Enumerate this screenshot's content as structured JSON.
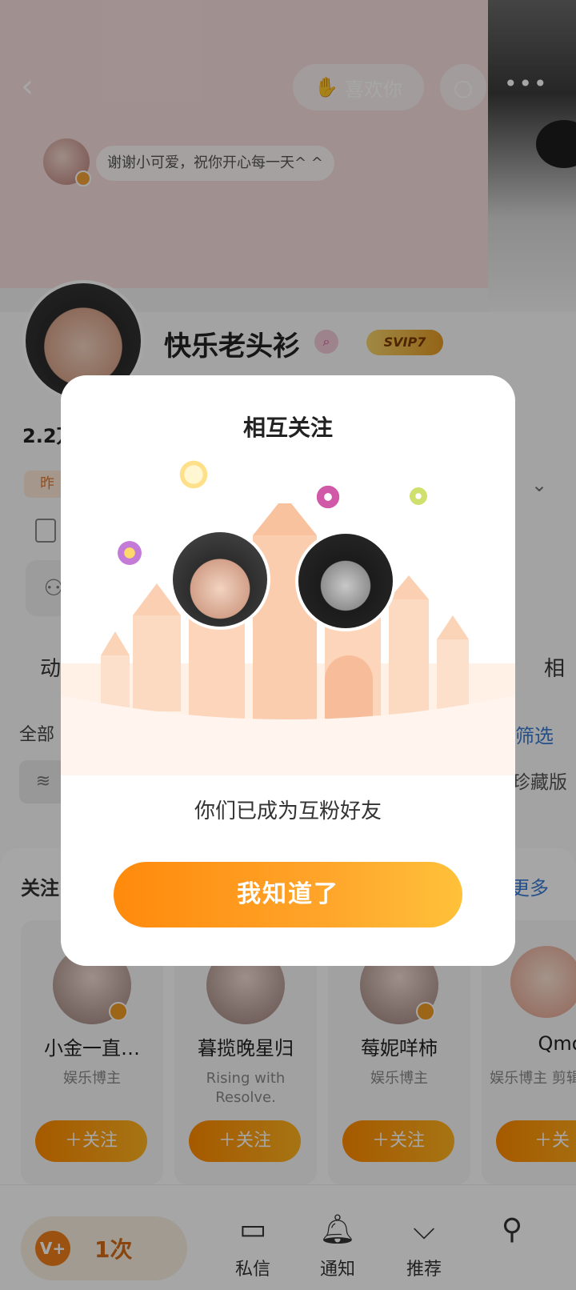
{
  "topbar": {
    "back_icon": "chevron-left-icon",
    "like_label": "喜欢你",
    "search_icon": "search-icon",
    "more_icon": "more-icon"
  },
  "pinned_message": {
    "text": "谢谢小可爱，祝你开心每一天^ ^"
  },
  "profile": {
    "nickname": "快乐老头衫",
    "svip_badge": "SVIP7",
    "stat_prefix": "2.2万",
    "tag_prefix": "昨"
  },
  "tabs": {
    "left": "动",
    "right": "相"
  },
  "filter": {
    "all_label": "全部",
    "filter_label": "筛选",
    "collector_label": "珍藏版"
  },
  "follow_section": {
    "title": "关注",
    "more_label": "更多",
    "cards": [
      {
        "name": "小金一直…",
        "desc": "娱乐博主",
        "button": "＋关注"
      },
      {
        "name": "暮揽晚星归",
        "desc": "Rising with Resolve.",
        "button": "＋关注"
      },
      {
        "name": "莓妮咩柿",
        "desc": "娱乐博主",
        "button": "＋关注"
      },
      {
        "name": "Qmo",
        "desc": "娱乐博主 剪辑视频",
        "button": "＋关"
      }
    ]
  },
  "bottom_nav": {
    "vpill_text": "1次",
    "items": [
      {
        "label": "私信",
        "icon": "message-icon"
      },
      {
        "label": "通知",
        "icon": "bell-icon"
      },
      {
        "label": "推荐",
        "icon": "chevron-circle-icon"
      },
      {
        "label": "",
        "icon": "user-switch-icon"
      }
    ]
  },
  "modal": {
    "title": "相互关注",
    "message": "你们已成为互粉好友",
    "button_label": "我知道了"
  },
  "colors": {
    "accent_orange": "#ff8a0c",
    "link_blue": "#3a7bd5"
  }
}
